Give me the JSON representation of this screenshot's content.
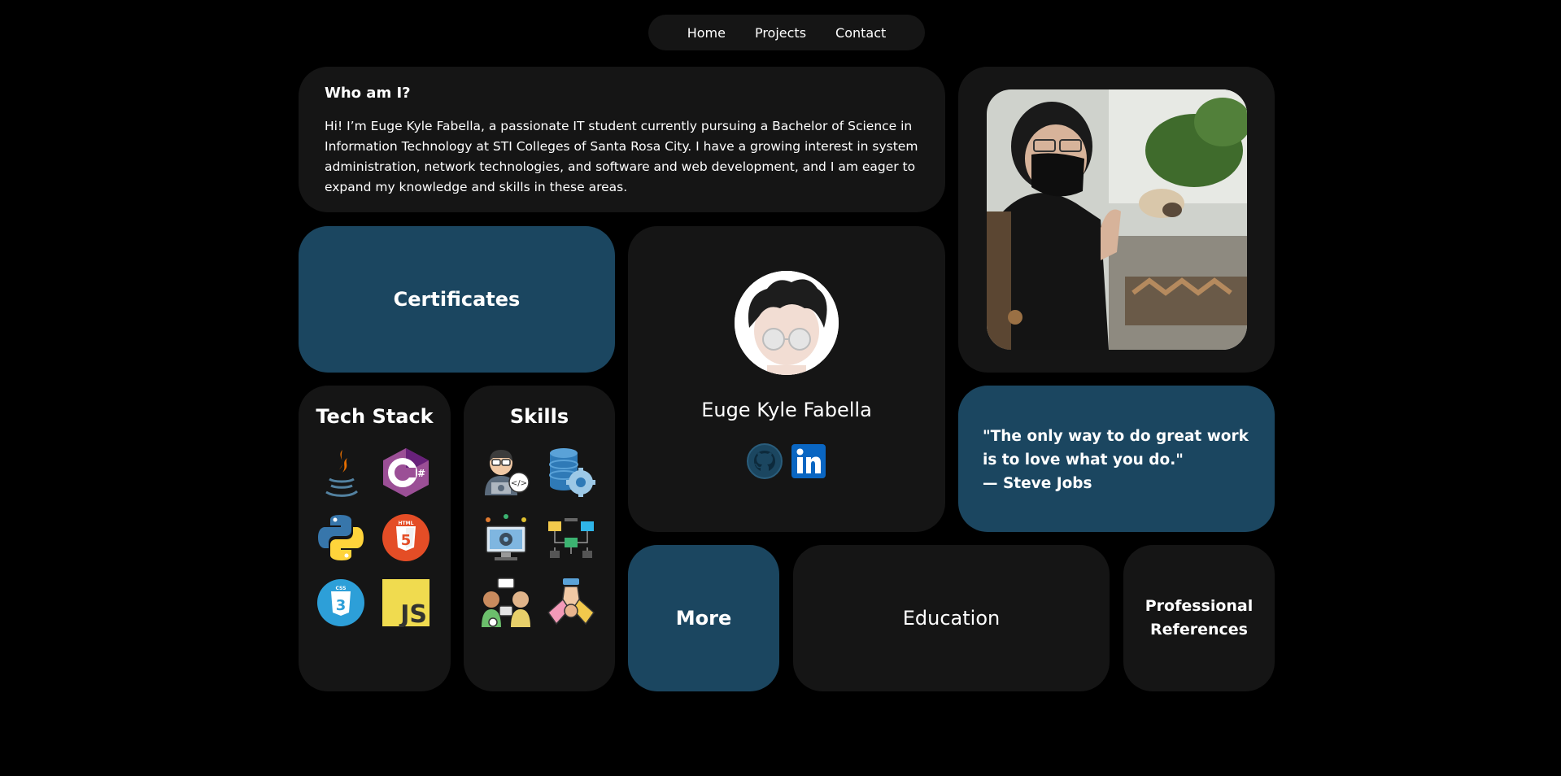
{
  "nav": {
    "home": "Home",
    "projects": "Projects",
    "contact": "Contact"
  },
  "about": {
    "title": "Who am I?",
    "body": "Hi! I’m Euge Kyle Fabella, a passionate IT student currently pursuing a Bachelor of Science in Information Technology at STI Colleges of Santa Rosa City. I have a growing interest in system administration, network technologies, and software and web development, and I am eager to expand my knowledge and skills in these areas."
  },
  "certificates": "Certificates",
  "profile": {
    "name": "Euge Kyle Fabella",
    "social_icons": [
      "github-icon",
      "linkedin-icon"
    ]
  },
  "quote": {
    "text": "\"The only way to do great work is to love what you do.\"",
    "author": "— Steve Jobs"
  },
  "techstack": {
    "title": "Tech Stack",
    "icons": [
      "java-icon",
      "csharp-icon",
      "python-icon",
      "html5-icon",
      "css3-icon",
      "javascript-icon"
    ]
  },
  "skills": {
    "title": "Skills",
    "icons": [
      "developer-icon",
      "database-settings-icon",
      "system-admin-icon",
      "network-icon",
      "communication-icon",
      "teamwork-icon"
    ]
  },
  "tiles": {
    "more": "More",
    "education": "Education",
    "references": "Professional References"
  },
  "colors": {
    "background": "#000000",
    "card": "#151515",
    "accent": "#1b4660"
  }
}
